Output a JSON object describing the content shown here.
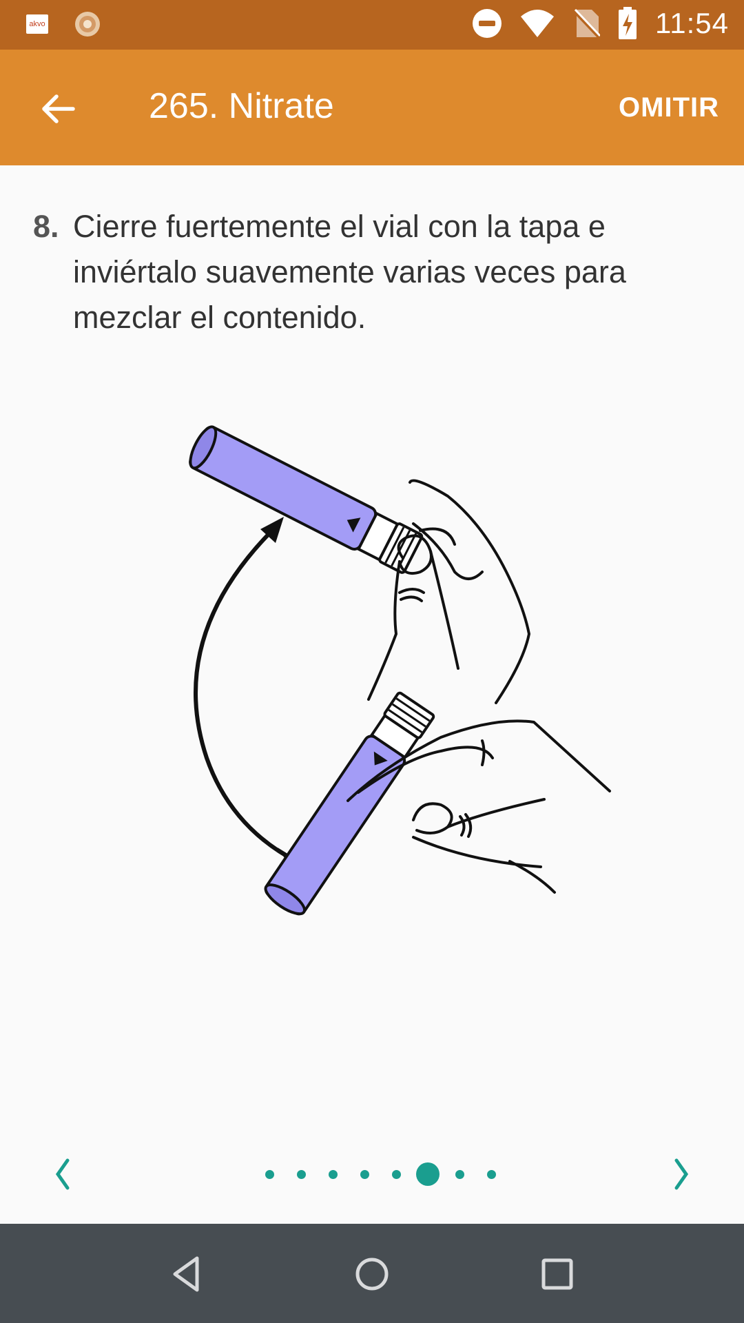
{
  "status_bar": {
    "time": "11:54",
    "left_icons": [
      "akvo-app-icon",
      "sun-icon"
    ],
    "right_icons": [
      "do-not-disturb-icon",
      "wifi-icon",
      "no-sim-icon",
      "battery-charging-icon"
    ],
    "akvo_label": "akvo"
  },
  "app_bar": {
    "title": "265. Nitrate",
    "skip_label": "OMITIR"
  },
  "instruction": {
    "number": "8.",
    "text": "Cierre fuertemente el vial con la tapa e inviértalo suavemente varias veces para mezclar el contenido."
  },
  "pager": {
    "total": 8,
    "current": 6,
    "accent_color": "#1a9e8f"
  },
  "colors": {
    "status_bar": "#b7651f",
    "app_bar": "#de8a2d",
    "vial": "#a39cf6",
    "nav_bar": "#474d52"
  }
}
